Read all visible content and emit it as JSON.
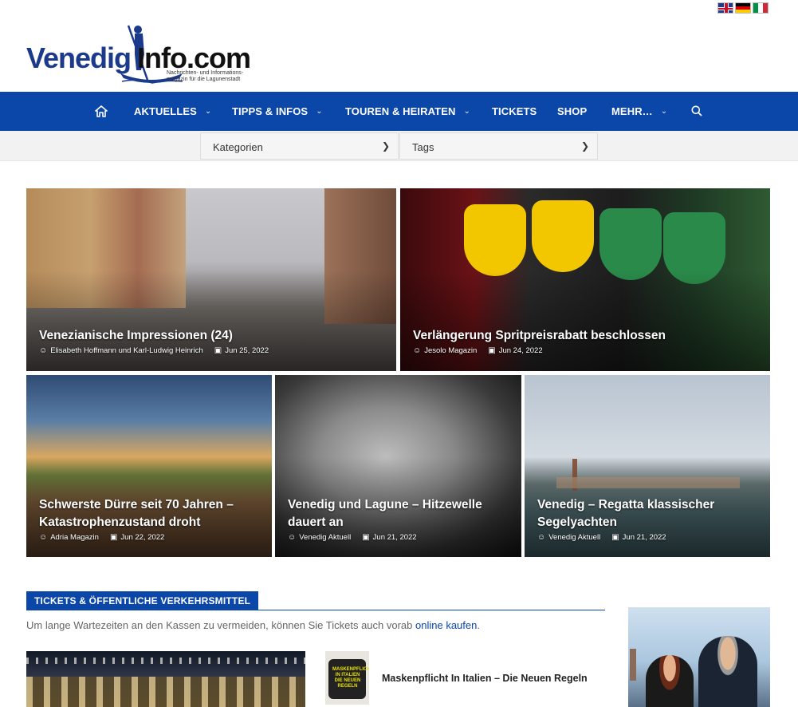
{
  "flags": [
    {
      "name": "english",
      "color": "#1f3a8a"
    },
    {
      "name": "german",
      "color": "#dd0000"
    },
    {
      "name": "italian",
      "color": "#009246"
    }
  ],
  "logo": {
    "name_part": "Venedig",
    "domain_part": "Info.com",
    "tagline_line1": "Nachrichten- und Informations-",
    "tagline_line2": "magazin für die Lagunenstadt"
  },
  "nav": {
    "home_icon": "home-icon",
    "items": [
      {
        "label": "AKTUELLES",
        "has_dropdown": true
      },
      {
        "label": "TIPPS & INFOS",
        "has_dropdown": true
      },
      {
        "label": "TOUREN & HEIRATEN",
        "has_dropdown": true
      },
      {
        "label": "TICKETS",
        "has_dropdown": false
      },
      {
        "label": "SHOP",
        "has_dropdown": false
      },
      {
        "label": "MEHR…",
        "has_dropdown": true
      }
    ],
    "search_icon": "search-icon",
    "accent": "#0a47a9"
  },
  "filters": {
    "categories": "Kategorien",
    "tags": "Tags"
  },
  "featured": [
    {
      "title": "Venezianische Impressionen (24)",
      "author": "Elisabeth Hoffmann und Karl-Ludwig Heinrich",
      "date": "Jun 25, 2022"
    },
    {
      "title": "Verlängerung Spritpreisrabatt beschlossen",
      "author": "Jesolo Magazin",
      "date": "Jun 24, 2022"
    },
    {
      "title_line1": "Schwerste Dürre seit 70 Jahren –",
      "title_line2": "Katastrophenzustand droht",
      "author": "Adria Magazin",
      "date": "Jun 22, 2022"
    },
    {
      "title_line1": "Venedig und Lagune – Hitzewelle",
      "title_line2": "dauert an",
      "author": "Venedig Aktuell",
      "date": "Jun 21, 2022"
    },
    {
      "title_line1": "Venedig – Regatta klassischer",
      "title_line2": "Segelyachten",
      "author": "Venedig Aktuell",
      "date": "Jun 21, 2022"
    }
  ],
  "section": {
    "heading": "TICKETS & ÖFFENTLICHE VERKEHRSMITTEL",
    "intro_text": "Um lange Wartezeiten an den Kassen zu vermeiden, können Sie Tickets auch vorab ",
    "intro_link": "online kaufen",
    "intro_end": ".",
    "side_article_title": "Maskenpflicht In Italien – Die Neuen Regeln",
    "thumb_text_line1": "MASKENPFLICHT",
    "thumb_text_line2": "IN ITALIEN",
    "thumb_text_line3": "DIE NEUEN",
    "thumb_text_line4": "REGELN"
  }
}
